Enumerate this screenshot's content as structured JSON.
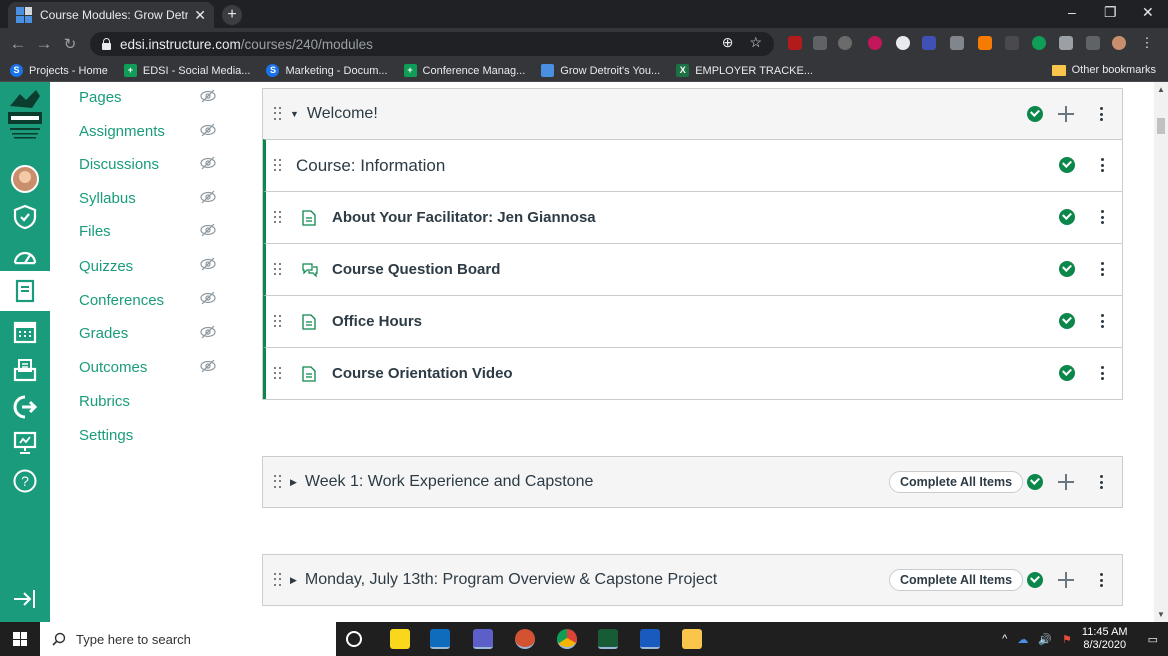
{
  "browser": {
    "tab_title": "Course Modules: Grow Detroit's",
    "new_tab": "+",
    "url_host": "edsi.instructure.com",
    "url_path": "/courses/240/modules",
    "window_controls": [
      "–",
      "❐",
      "✕"
    ],
    "bookmarks": [
      {
        "label": "Projects - Home",
        "color": "#1a73e8",
        "letter": "S"
      },
      {
        "label": "EDSI - Social Media...",
        "color": "#0f9d58",
        "letter": "+"
      },
      {
        "label": "Marketing - Docum...",
        "color": "#1a73e8",
        "letter": "S"
      },
      {
        "label": "Conference Manag...",
        "color": "#0f9d58",
        "letter": "+"
      },
      {
        "label": "Grow Detroit's You...",
        "color": "#4a90e2",
        "letter": ""
      },
      {
        "label": "EMPLOYER TRACKE...",
        "color": "#1e7145",
        "letter": "X"
      }
    ],
    "other_bookmarks": "Other bookmarks"
  },
  "course_nav": {
    "items": [
      {
        "label": "Pages",
        "hidden": true
      },
      {
        "label": "Assignments",
        "hidden": true
      },
      {
        "label": "Discussions",
        "hidden": true
      },
      {
        "label": "Syllabus",
        "hidden": true
      },
      {
        "label": "Files",
        "hidden": true
      },
      {
        "label": "Quizzes",
        "hidden": true
      },
      {
        "label": "Conferences",
        "hidden": true
      },
      {
        "label": "Grades",
        "hidden": true
      },
      {
        "label": "Outcomes",
        "hidden": true
      },
      {
        "label": "Rubrics",
        "hidden": false
      },
      {
        "label": "Settings",
        "hidden": false
      }
    ]
  },
  "modules": [
    {
      "title": "Welcome!",
      "expanded": true,
      "items": [
        {
          "type": "subheader",
          "title": "Course: Information"
        },
        {
          "type": "page",
          "title": "About Your Facilitator: Jen Giannosa"
        },
        {
          "type": "discussion",
          "title": "Course Question Board"
        },
        {
          "type": "page",
          "title": "Office Hours"
        },
        {
          "type": "page",
          "title": "Course Orientation Video"
        }
      ]
    },
    {
      "title": "Week 1: Work Experience and Capstone",
      "expanded": false,
      "button": "Complete All Items"
    },
    {
      "title": "Monday, July 13th: Program Overview & Capstone Project",
      "expanded": false,
      "button": "Complete All Items"
    }
  ],
  "taskbar": {
    "search_placeholder": "Type here to search",
    "time": "11:45 AM",
    "date": "8/3/2020"
  },
  "colors": {
    "canvas_green": "#1a9c7c",
    "complete_green": "#0b874b"
  }
}
